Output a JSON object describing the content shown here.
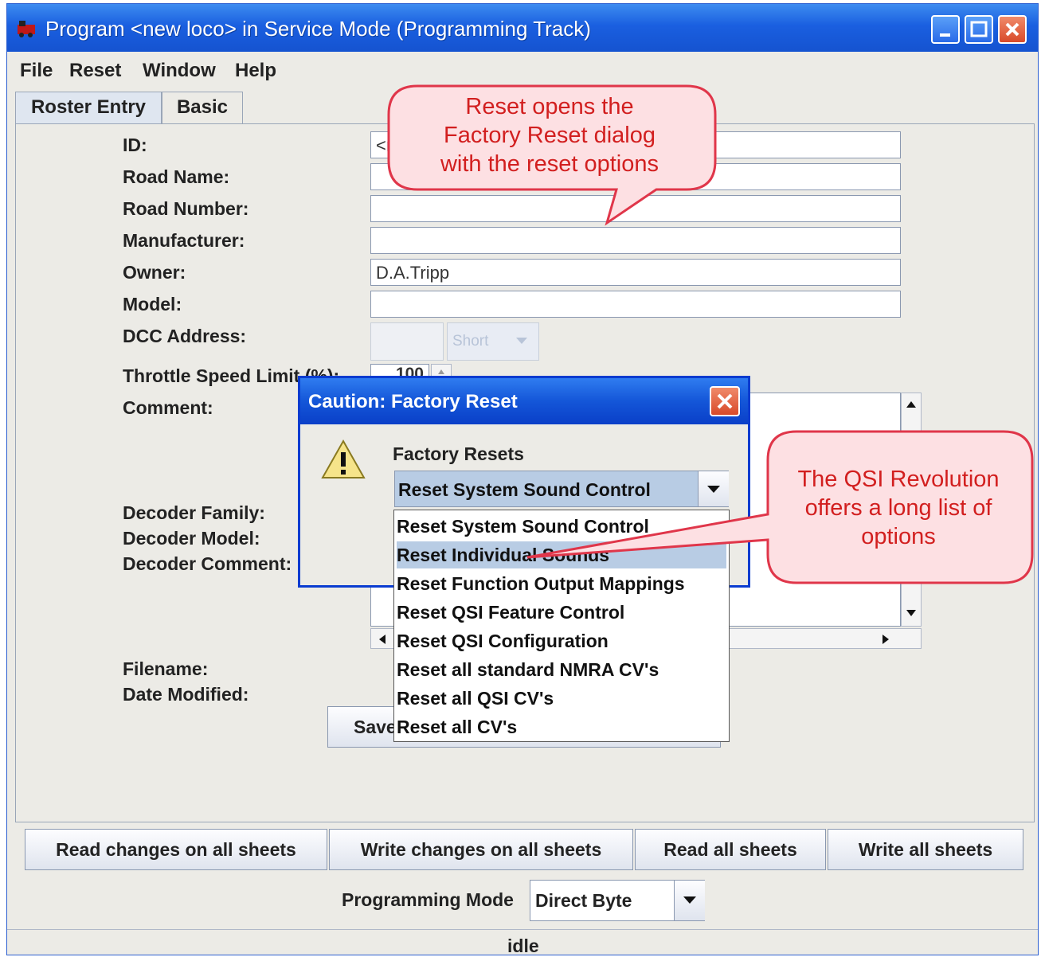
{
  "window": {
    "title": "Program <new loco> in Service Mode (Programming Track)"
  },
  "menu": [
    "File",
    "Reset",
    "Window",
    "Help"
  ],
  "tabs": [
    "Roster Entry",
    "Basic"
  ],
  "roster": {
    "id_label": "ID:",
    "id_value": "<n",
    "road_name_label": "Road Name:",
    "road_number_label": "Road Number:",
    "manufacturer_label": "Manufacturer:",
    "owner_label": "Owner:",
    "owner_value": "D.A.Tripp",
    "model_label": "Model:",
    "dcc_address_label": "DCC Address:",
    "dcc_type_value": "Short",
    "throttle_label": "Throttle Speed Limit (%):",
    "throttle_value": "100",
    "comment_label": "Comment:",
    "decoder_family_label": "Decoder Family:",
    "decoder_model_label": "Decoder Model:",
    "decoder_comment_label": "Decoder Comment:",
    "filename_label": "Filename:",
    "date_modified_label": "Date Modified:",
    "save_label": "Save"
  },
  "dialog": {
    "title": "Caution: Factory Reset",
    "group_label": "Factory Resets",
    "selected": "Reset System Sound Control",
    "options": [
      "Reset System Sound Control",
      "Reset Individual Sounds",
      "Reset Function Output Mappings",
      "Reset QSI Feature Control",
      "Reset QSI Configuration",
      "Reset all standard NMRA CV's",
      "Reset all QSI CV's",
      "Reset all CV's"
    ],
    "highlighted_index": 1
  },
  "bottom_buttons": [
    "Read changes on all sheets",
    "Write changes on all sheets",
    "Read all sheets",
    "Write all sheets"
  ],
  "programming": {
    "label": "Programming Mode",
    "value": "Direct Byte"
  },
  "status": "idle",
  "callouts": {
    "reset": [
      "Reset opens the",
      "Factory Reset dialog",
      "with the reset options"
    ],
    "qsi": [
      "The QSI Revolution",
      "offers a long list of",
      "options"
    ]
  },
  "colors": {
    "titlebar": "#1a5fe0",
    "dialog_border": "#0a3cd0",
    "callout_fill": "#fde0e3",
    "callout_border": "#e0364a",
    "callout_text": "#d21f1f",
    "highlight": "#b8cce4"
  }
}
